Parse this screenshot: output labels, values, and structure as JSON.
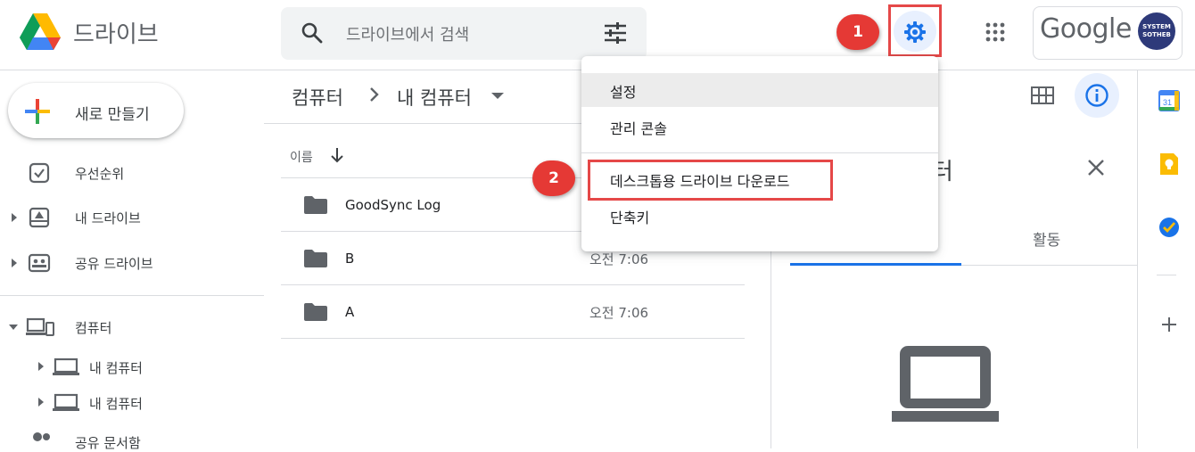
{
  "header": {
    "app_title": "드라이브",
    "search_placeholder": "드라이브에서 검색",
    "google_logo_text": "Google",
    "avatar_line1": "SYSTEM",
    "avatar_line2": "SOTHEB"
  },
  "annotations": {
    "marker1": "1",
    "marker2": "2"
  },
  "sidebar": {
    "new_button": "새로 만들기",
    "items": [
      {
        "label": "우선순위",
        "icon": "priority-check-icon"
      },
      {
        "label": "내 드라이브",
        "icon": "my-drive-icon"
      },
      {
        "label": "공유 드라이브",
        "icon": "shared-drive-icon"
      },
      {
        "label": "컴퓨터",
        "icon": "computers-icon"
      },
      {
        "label": "내 컴퓨터",
        "icon": "laptop-icon"
      },
      {
        "label": "내 컴퓨터",
        "icon": "laptop-icon"
      },
      {
        "label": "공유 문서함",
        "icon": "shared-people-icon"
      }
    ]
  },
  "main": {
    "breadcrumb_root": "컴퓨터",
    "breadcrumb_current": "내 컴퓨터",
    "col_name": "이름",
    "files": [
      {
        "name": "GoodSync Log",
        "time": ""
      },
      {
        "name": "B",
        "time": "오전 7:06"
      },
      {
        "name": "A",
        "time": "오전 7:06"
      }
    ]
  },
  "settings_menu": {
    "items": [
      "설정",
      "관리 콘솔",
      "데스크톱용 드라이브 다운로드",
      "단축키"
    ]
  },
  "details_panel": {
    "title_partial": "터",
    "tab_activity": "활동"
  },
  "colors": {
    "accent_blue": "#1a73e8",
    "marker_red": "#e53935",
    "highlight_red": "#e54848"
  }
}
